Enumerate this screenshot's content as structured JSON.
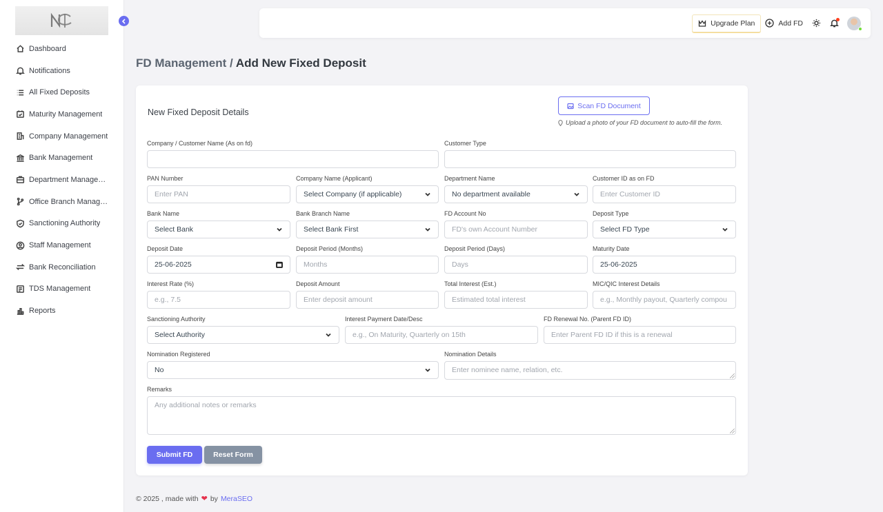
{
  "sidebar": {
    "items": [
      {
        "label": "Dashboard",
        "icon": "home-icon"
      },
      {
        "label": "Notifications",
        "icon": "bell-icon"
      },
      {
        "label": "All Fixed Deposits",
        "icon": "list-icon"
      },
      {
        "label": "Maturity Management",
        "icon": "calendar-check-icon"
      },
      {
        "label": "Company Management",
        "icon": "building-icon"
      },
      {
        "label": "Bank Management",
        "icon": "bank-icon"
      },
      {
        "label": "Department Management",
        "icon": "briefcase-icon"
      },
      {
        "label": "Office Branch Management",
        "icon": "git-branch-icon"
      },
      {
        "label": "Sanctioning Authority",
        "icon": "shield-check-icon"
      },
      {
        "label": "Staff Management",
        "icon": "user-circle-icon"
      },
      {
        "label": "Bank Reconciliation",
        "icon": "arrows-exchange-icon"
      },
      {
        "label": "TDS Management",
        "icon": "receipt-icon"
      },
      {
        "label": "Reports",
        "icon": "bar-chart-icon"
      }
    ]
  },
  "topbar": {
    "upgrade_label": "Upgrade Plan",
    "add_fd_label": "Add FD"
  },
  "page": {
    "crumb": "FD Management /",
    "title": "Add New Fixed Deposit"
  },
  "form": {
    "title": "New Fixed Deposit Details",
    "scan_label": "Scan FD Document",
    "scan_hint": "Upload a photo of your FD document to auto-fill the form.",
    "fields": {
      "company_customer_name": {
        "label": "Company / Customer Name (As on fd)",
        "value": ""
      },
      "customer_type": {
        "label": "Customer Type",
        "value": ""
      },
      "pan": {
        "label": "PAN Number",
        "placeholder": "Enter PAN"
      },
      "company_applicant": {
        "label": "Company Name (Applicant)",
        "value": "Select Company (if applicable)"
      },
      "department": {
        "label": "Department Name",
        "value": "No department available"
      },
      "customer_id": {
        "label": "Customer ID as on FD",
        "placeholder": "Enter Customer ID"
      },
      "bank_name": {
        "label": "Bank Name",
        "value": "Select Bank"
      },
      "bank_branch": {
        "label": "Bank Branch Name",
        "value": "Select Bank First"
      },
      "fd_account": {
        "label": "FD Account No",
        "placeholder": "FD's own Account Number"
      },
      "deposit_type": {
        "label": "Deposit Type",
        "value": "Select FD Type"
      },
      "deposit_date": {
        "label": "Deposit Date",
        "value": "25-06-2025"
      },
      "period_months": {
        "label": "Deposit Period (Months)",
        "placeholder": "Months"
      },
      "period_days": {
        "label": "Deposit Period (Days)",
        "placeholder": "Days"
      },
      "maturity_date": {
        "label": "Maturity Date",
        "value": "25-06-2025"
      },
      "interest_rate": {
        "label": "Interest Rate (%)",
        "placeholder": "e.g., 7.5"
      },
      "deposit_amount": {
        "label": "Deposit Amount",
        "placeholder": "Enter deposit amount"
      },
      "total_interest": {
        "label": "Total Interest (Est.)",
        "placeholder": "Estimated total interest"
      },
      "mic_qic": {
        "label": "MIC/QIC Interest Details",
        "placeholder": "e.g., Monthly payout, Quarterly compou"
      },
      "sanctioning_authority": {
        "label": "Sanctioning Authority",
        "value": "Select Authority"
      },
      "interest_payment": {
        "label": "Interest Payment Date/Desc",
        "placeholder": "e.g., On Maturity, Quarterly on 15th"
      },
      "renewal_no": {
        "label": "FD Renewal No. (Parent FD ID)",
        "placeholder": "Enter Parent FD ID if this is a renewal"
      },
      "nomination_registered": {
        "label": "Nomination Registered",
        "value": "No"
      },
      "nomination_details": {
        "label": "Nomination Details",
        "placeholder": "Enter nominee name, relation, etc."
      },
      "remarks": {
        "label": "Remarks",
        "placeholder": "Any additional notes or remarks"
      }
    },
    "submit_label": "Submit FD",
    "reset_label": "Reset Form"
  },
  "footer": {
    "prefix": "© 2025 , made with",
    "by": "by",
    "brand": "MeraSEO"
  },
  "colors": {
    "accent": "#6a6df0",
    "secondary_button": "#8592a3",
    "background": "#f3f3f6"
  }
}
